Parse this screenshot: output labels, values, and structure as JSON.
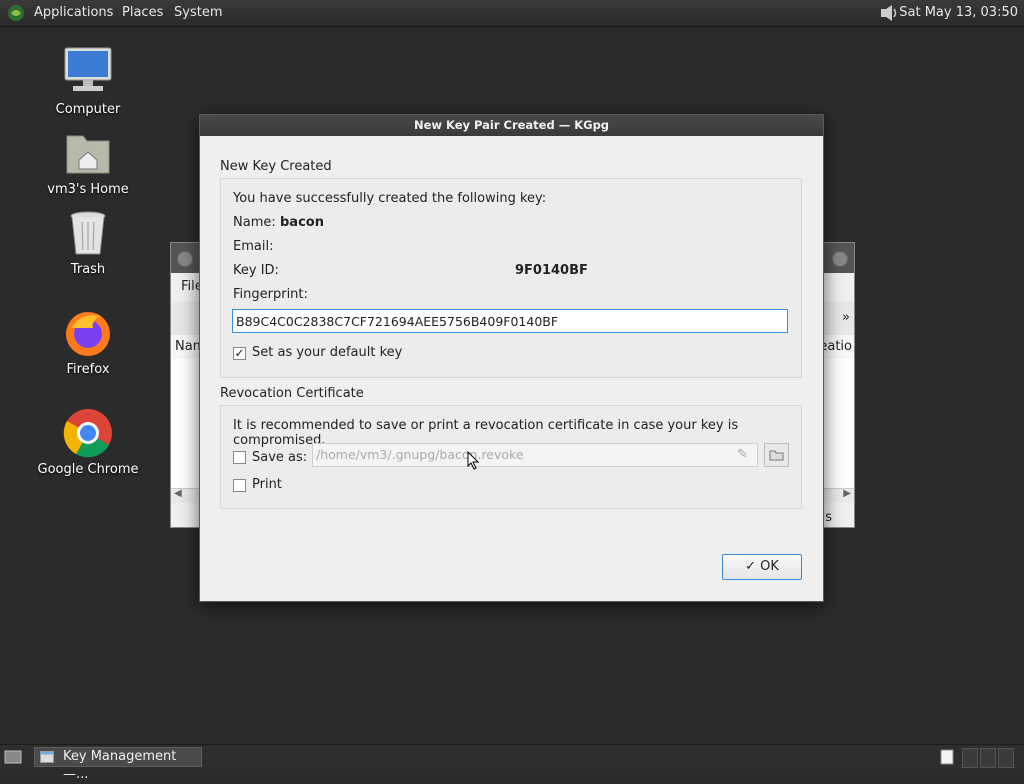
{
  "top_panel": {
    "menus": [
      "Applications",
      "Places",
      "System"
    ],
    "clock": "Sat May 13, 03:50"
  },
  "desktop": {
    "icons": [
      {
        "label": "Computer",
        "icon": "monitor-icon"
      },
      {
        "label": "vm3's Home",
        "icon": "home-folder-icon"
      },
      {
        "label": "Trash",
        "icon": "trash-icon"
      },
      {
        "label": "Firefox",
        "icon": "firefox-icon"
      },
      {
        "label": "Google Chrome",
        "icon": "chrome-icon"
      }
    ]
  },
  "background_window": {
    "menu_partial": "File",
    "col_left_partial": "Nam",
    "col_right_partial": "reatio",
    "status_partial": "s"
  },
  "dialog": {
    "title": "New Key Pair Created — KGpg",
    "new_key_group": {
      "title": "New Key Created",
      "intro": "You have successfully created the following key:",
      "name_label": "Name:",
      "name_value": "bacon",
      "email_label": "Email:",
      "email_value": "",
      "keyid_label": "Key ID:",
      "keyid_value": "9F0140BF",
      "fingerprint_label": "Fingerprint:",
      "fingerprint_value": "B89C4C0C2838C7CF721694AEE5756B409F0140BF",
      "default_key_label": "Set as your default key",
      "default_key_checked": true
    },
    "revocation_group": {
      "title": "Revocation Certificate",
      "recommendation": "It is recommended to save or print a revocation certificate in case your key is compromised.",
      "save_as_label": "Save as:",
      "save_as_checked": false,
      "save_path": "/home/vm3/.gnupg/bacon.revoke",
      "print_label": "Print",
      "print_checked": false
    },
    "ok_label": "OK"
  },
  "taskbar": {
    "task_label": "Key Management —..."
  }
}
